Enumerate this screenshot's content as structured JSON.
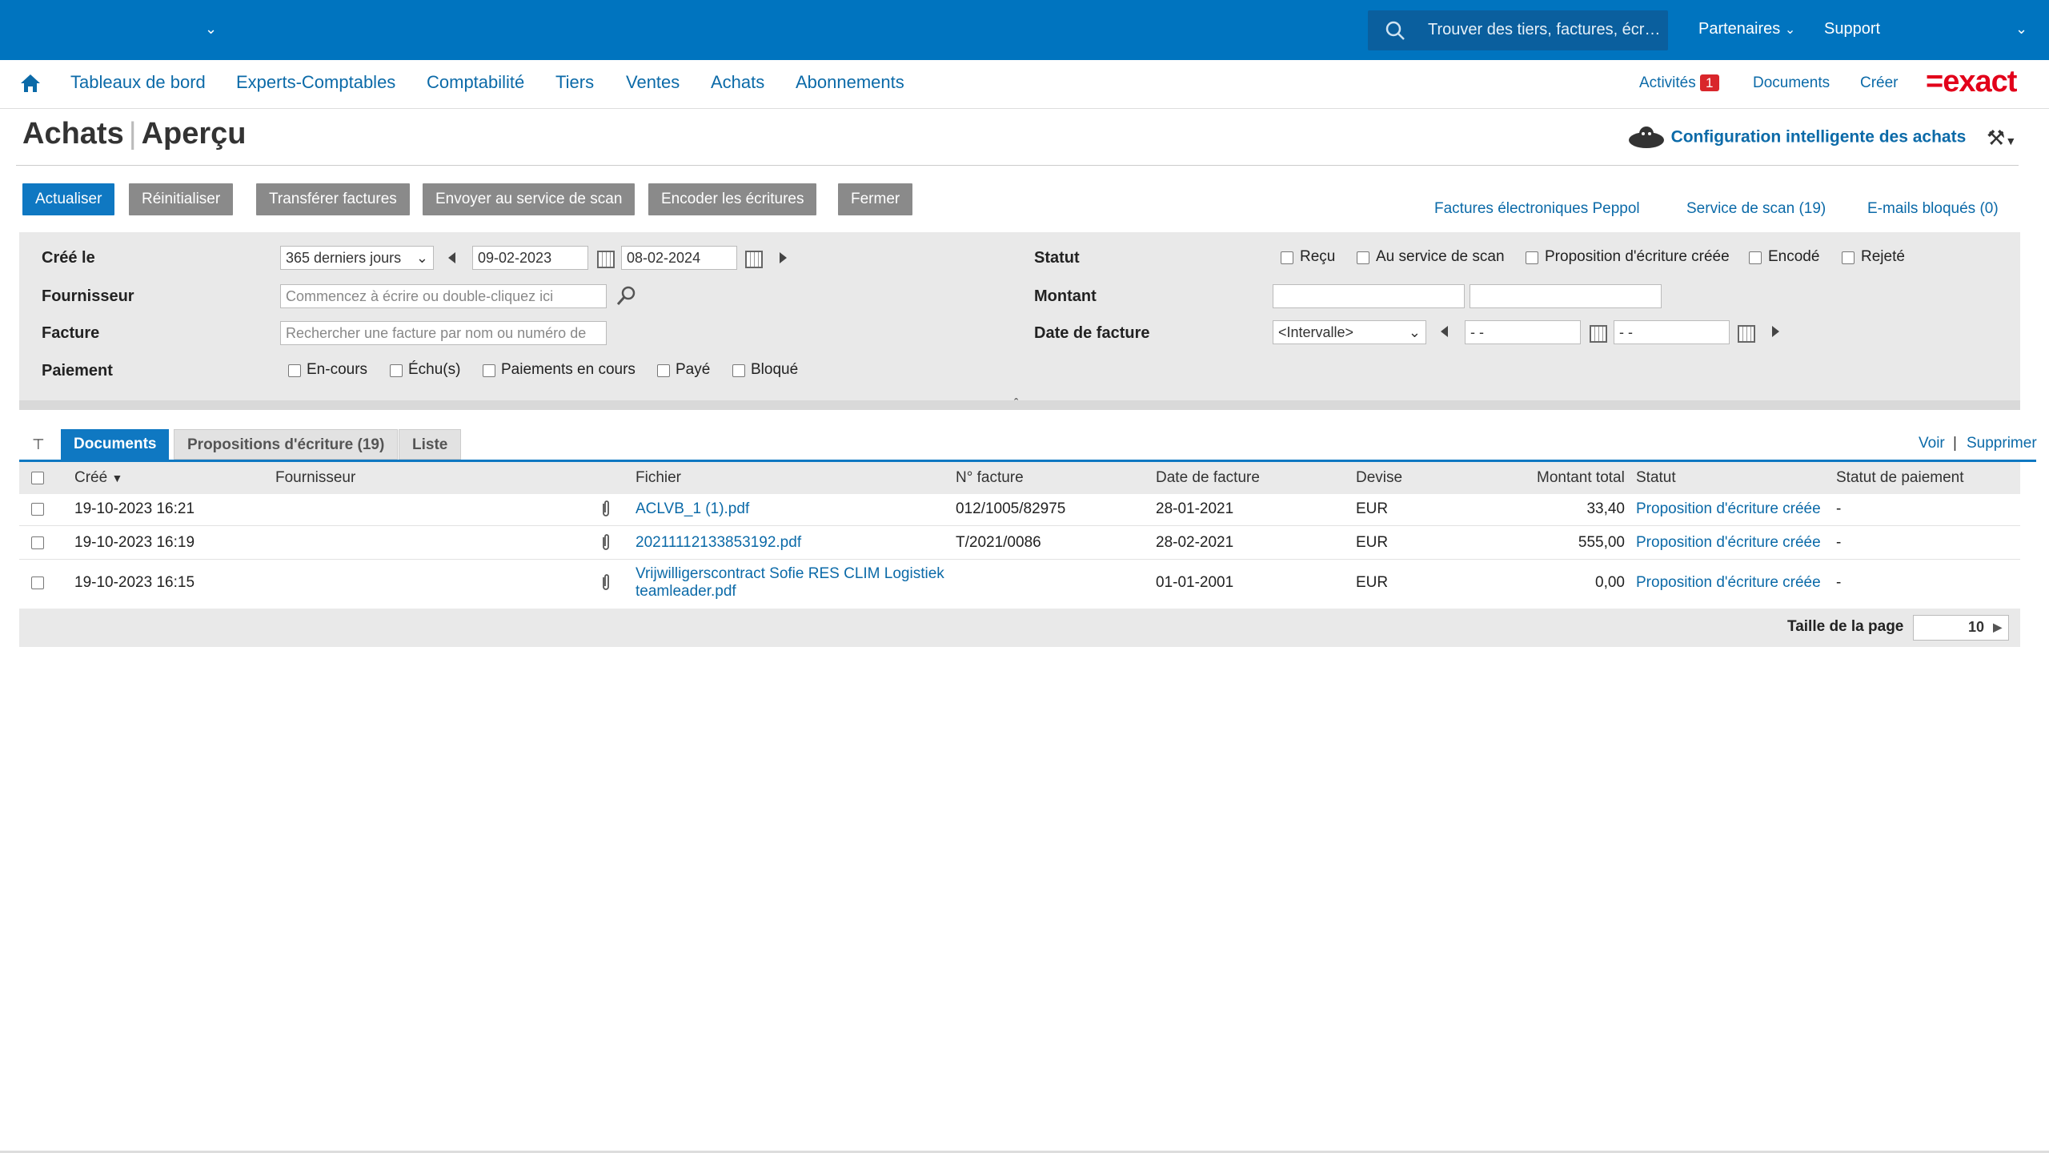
{
  "topbar": {
    "search_placeholder": "Trouver des tiers, factures, écr…",
    "partners_label": "Partenaires",
    "support_label": "Support",
    "bg_color": "#0074bf"
  },
  "nav": {
    "items": [
      "Tableaux de bord",
      "Experts-Comptables",
      "Comptabilité",
      "Tiers",
      "Ventes",
      "Achats",
      "Abonnements"
    ],
    "activities_label": "Activités",
    "activities_count": "1",
    "documents_label": "Documents",
    "create_label": "Créer",
    "logo_text": "=exact"
  },
  "page": {
    "title_main": "Achats",
    "title_sub": "Aperçu",
    "smart_config_label": "Configuration intelligente des achats"
  },
  "actions": {
    "refresh": "Actualiser",
    "reset": "Réinitialiser",
    "transfer": "Transférer factures",
    "send_scan": "Envoyer au service de scan",
    "encode": "Encoder les écritures",
    "close": "Fermer"
  },
  "links": {
    "peppol": "Factures électroniques Peppol",
    "scan_service": "Service de scan (19)",
    "blocked_emails": "E-mails bloqués (0)"
  },
  "filters": {
    "created_label": "Créé le",
    "created_range": "365 derniers jours",
    "date_from": "09-02-2023",
    "date_to": "08-02-2024",
    "supplier_label": "Fournisseur",
    "supplier_placeholder": "Commencez à écrire ou double-cliquez ici",
    "invoice_label": "Facture",
    "invoice_placeholder": "Rechercher une facture par nom ou numéro de",
    "payment_label": "Paiement",
    "payment_options": [
      "En-cours",
      "Échu(s)",
      "Paiements en cours",
      "Payé",
      "Bloqué"
    ],
    "status_label": "Statut",
    "status_options": [
      "Reçu",
      "Au service de scan",
      "Proposition d'écriture créée",
      "Encodé",
      "Rejeté"
    ],
    "amount_label": "Montant",
    "invoice_date_label": "Date de facture",
    "invoice_date_range": "<Intervalle>",
    "invoice_date_from": "- -",
    "invoice_date_to": "- -"
  },
  "tabs": {
    "pin_icon": "pin-icon",
    "items": [
      "Documents",
      "Propositions d'écriture (19)",
      "Liste"
    ],
    "view_label": "Voir",
    "separator": "|",
    "delete_label": "Supprimer"
  },
  "table": {
    "headers": [
      "Créé",
      "Fournisseur",
      "Fichier",
      "N° facture",
      "Date de facture",
      "Devise",
      "Montant total",
      "Statut",
      "Statut de paiement"
    ],
    "rows": [
      {
        "created": "19-10-2023 16:21",
        "supplier": "",
        "file": "ACLVB_1 (1).pdf",
        "file2": "",
        "invoice_no": "012/1005/82975",
        "invoice_date": "28-01-2021",
        "currency": "EUR",
        "total": "33,40",
        "status": "Proposition d'écriture créée",
        "payment_status": "-"
      },
      {
        "created": "19-10-2023 16:19",
        "supplier": "",
        "file": "20211112133853192.pdf",
        "file2": "",
        "invoice_no": "T/2021/0086",
        "invoice_date": "28-02-2021",
        "currency": "EUR",
        "total": "555,00",
        "status": "Proposition d'écriture créée",
        "payment_status": "-"
      },
      {
        "created": "19-10-2023 16:15",
        "supplier": "",
        "file": "Vrijwilligerscontract Sofie RES CLIM Logistiek",
        "file2": "teamleader.pdf",
        "invoice_no": "",
        "invoice_date": "01-01-2001",
        "currency": "EUR",
        "total": "0,00",
        "status": "Proposition d'écriture créée",
        "payment_status": "-"
      }
    ],
    "page_size_label": "Taille de la page",
    "page_size": "10"
  }
}
